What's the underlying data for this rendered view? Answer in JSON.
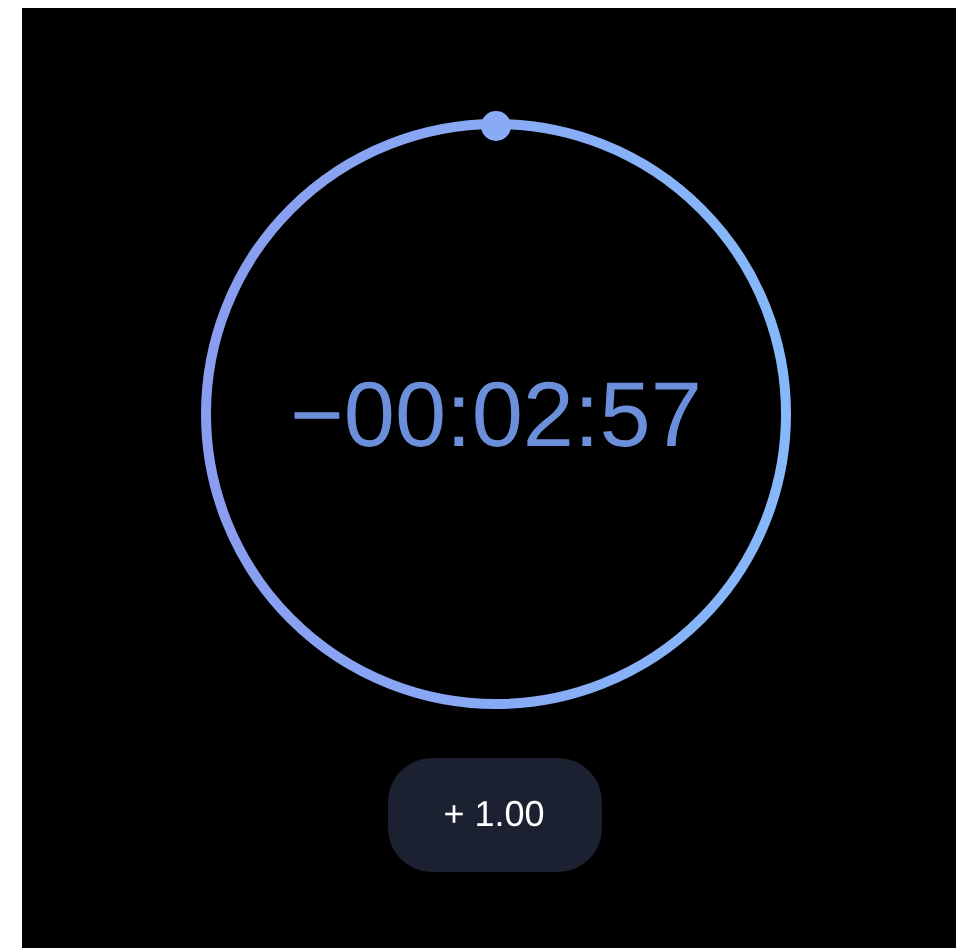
{
  "timer": {
    "time": "−00:02:57"
  },
  "add_button": {
    "label": "+ 1.00"
  }
}
